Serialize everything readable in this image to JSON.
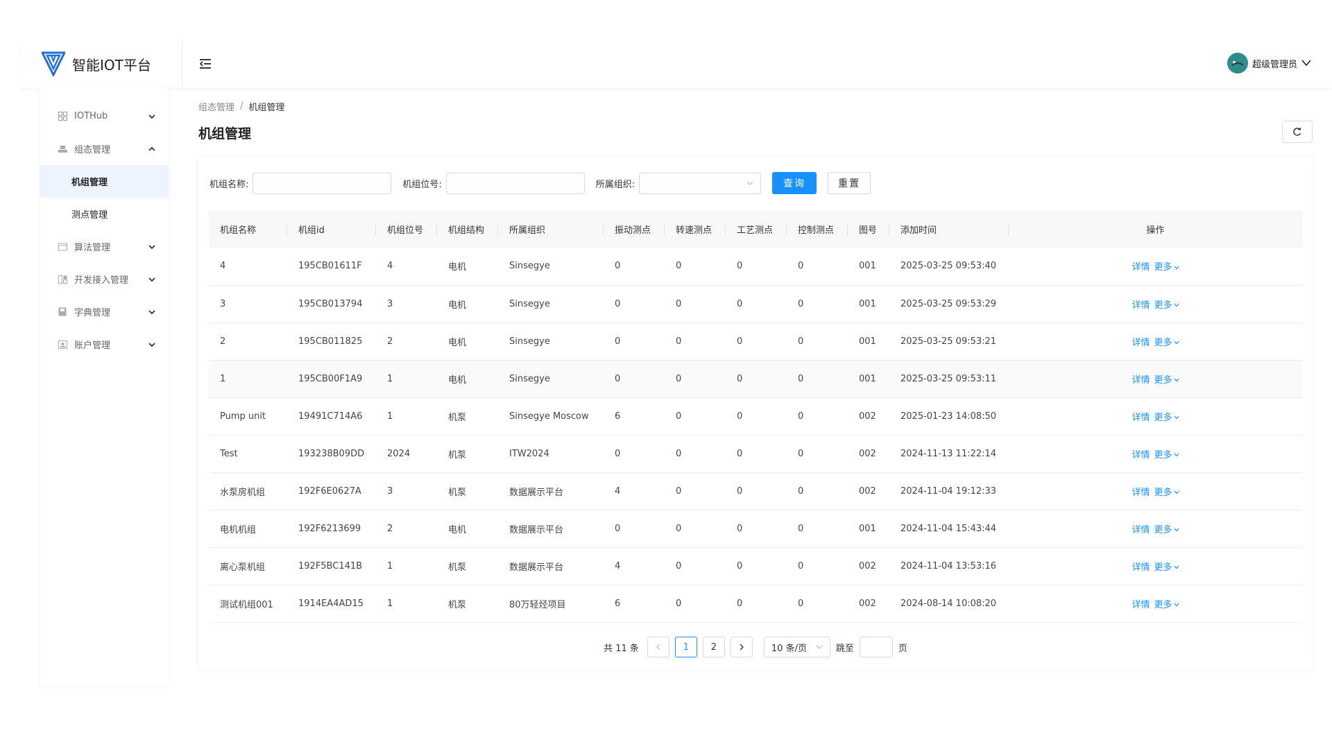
{
  "app": {
    "title": "智能IOT平台",
    "brand_color": "#1f6fd6",
    "accent_color": "#1890ff"
  },
  "header": {
    "menu_icon": "menu-fold-icon",
    "user_name": "超级管理员"
  },
  "sidebar": {
    "items": [
      {
        "label": "IOTHub",
        "icon": "grid-icon",
        "expanded": false
      },
      {
        "label": "组态管理",
        "icon": "config-icon",
        "expanded": true,
        "children": [
          {
            "label": "机组管理",
            "active": true
          },
          {
            "label": "测点管理",
            "active": false
          }
        ]
      },
      {
        "label": "算法管理",
        "icon": "algorithm-icon",
        "expanded": false
      },
      {
        "label": "开发接入管理",
        "icon": "dev-icon",
        "expanded": false
      },
      {
        "label": "字典管理",
        "icon": "dictionary-icon",
        "expanded": false
      },
      {
        "label": "账户管理",
        "icon": "account-icon",
        "expanded": false
      }
    ]
  },
  "breadcrumb": {
    "parent": "组态管理",
    "separator": "/",
    "current": "机组管理"
  },
  "page": {
    "title": "机组管理",
    "refresh_icon": "refresh-icon"
  },
  "filters": {
    "name_label": "机组名称:",
    "name_value": "",
    "position_label": "机组位号:",
    "position_value": "",
    "org_label": "所属组织:",
    "org_value": "",
    "search_button": "查询",
    "reset_button": "重置"
  },
  "table": {
    "columns": [
      "机组名称",
      "机组id",
      "机组位号",
      "机组结构",
      "所属组织",
      "振动测点",
      "转速测点",
      "工艺测点",
      "控制测点",
      "图号",
      "添加时间",
      "操作"
    ],
    "rows": [
      [
        "4",
        "195CB01611F",
        "4",
        "电机",
        "Sinsegye",
        "0",
        "0",
        "0",
        "0",
        "001",
        "2025-03-25 09:53:40"
      ],
      [
        "3",
        "195CB013794",
        "3",
        "电机",
        "Sinsegye",
        "0",
        "0",
        "0",
        "0",
        "001",
        "2025-03-25 09:53:29"
      ],
      [
        "2",
        "195CB011825",
        "2",
        "电机",
        "Sinsegye",
        "0",
        "0",
        "0",
        "0",
        "001",
        "2025-03-25 09:53:21"
      ],
      [
        "1",
        "195CB00F1A9",
        "1",
        "电机",
        "Sinsegye",
        "0",
        "0",
        "0",
        "0",
        "001",
        "2025-03-25 09:53:11"
      ],
      [
        "Pump unit",
        "19491C714A6",
        "1",
        "机泵",
        "Sinsegye Moscow",
        "6",
        "0",
        "0",
        "0",
        "002",
        "2025-01-23 14:08:50"
      ],
      [
        "Test",
        "193238B09DD",
        "2024",
        "机泵",
        "ITW2024",
        "0",
        "0",
        "0",
        "0",
        "002",
        "2024-11-13 11:22:14"
      ],
      [
        "水泵房机组",
        "192F6E0627A",
        "3",
        "机泵",
        "数据展示平台",
        "4",
        "0",
        "0",
        "0",
        "002",
        "2024-11-04 19:12:33"
      ],
      [
        "电机机组",
        "192F6213699",
        "2",
        "电机",
        "数据展示平台",
        "0",
        "0",
        "0",
        "0",
        "001",
        "2024-11-04 15:43:44"
      ],
      [
        "离心泵机组",
        "192F5BC141B",
        "1",
        "机泵",
        "数据展示平台",
        "4",
        "0",
        "0",
        "0",
        "002",
        "2024-11-04 13:53:16"
      ],
      [
        "测试机组001",
        "1914EA4AD15",
        "1",
        "机泵",
        "80万轻烃项目",
        "6",
        "0",
        "0",
        "0",
        "002",
        "2024-08-14 10:08:20"
      ]
    ],
    "actions": {
      "detail": "详情",
      "more": "更多"
    }
  },
  "pagination": {
    "total": "共 11 条",
    "pages": [
      "1",
      "2"
    ],
    "current": "1",
    "page_size": "10 条/页",
    "jump_label": "跳至",
    "jump_value": "",
    "page_unit": "页"
  }
}
